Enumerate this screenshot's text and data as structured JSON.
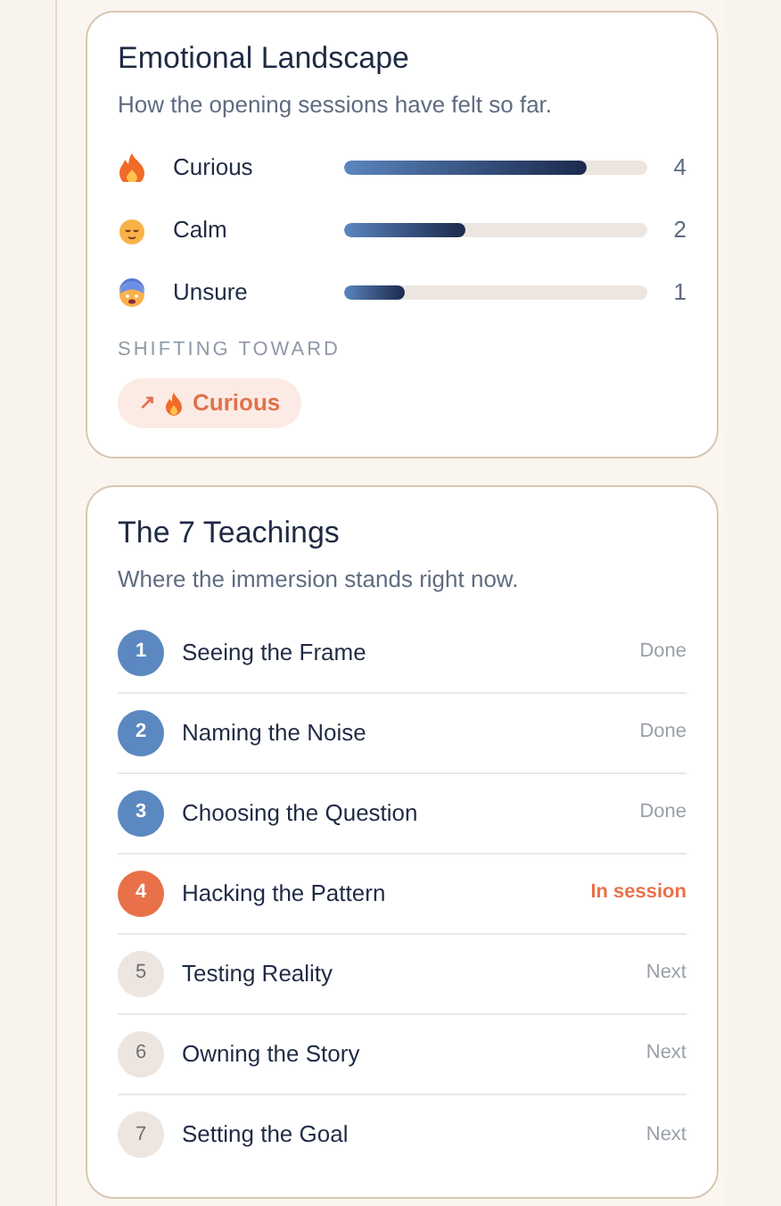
{
  "emotional_landscape": {
    "title": "Emotional Landscape",
    "subtitle": "How the opening sessions have felt so far.",
    "emotions": [
      {
        "label": "Curious",
        "level": 0.8,
        "count": "4"
      },
      {
        "label": "Calm",
        "level": 0.4,
        "count": "2"
      },
      {
        "label": "Unsure",
        "level": 0.2,
        "count": "1"
      }
    ],
    "shift_label": "SHIFTING TOWARD",
    "shift_badge": {
      "arrow": "↗",
      "label": "Curious"
    }
  },
  "teachings": {
    "title": "The 7 Teachings",
    "subtitle": "Where the immersion stands right now.",
    "items": [
      {
        "number": "1",
        "label": "Seeing the Frame",
        "status": "Done",
        "kind": "done"
      },
      {
        "number": "2",
        "label": "Naming the Noise",
        "status": "Done",
        "kind": "done"
      },
      {
        "number": "3",
        "label": "Choosing the Question",
        "status": "Done",
        "kind": "done"
      },
      {
        "number": "4",
        "label": "Hacking the Pattern",
        "status": "In session",
        "kind": "current"
      },
      {
        "number": "5",
        "label": "Testing Reality",
        "status": "Next",
        "kind": "next"
      },
      {
        "number": "6",
        "label": "Owning the Story",
        "status": "Next",
        "kind": "next"
      },
      {
        "number": "7",
        "label": "Setting the Goal",
        "status": "Next",
        "kind": "next"
      }
    ]
  }
}
